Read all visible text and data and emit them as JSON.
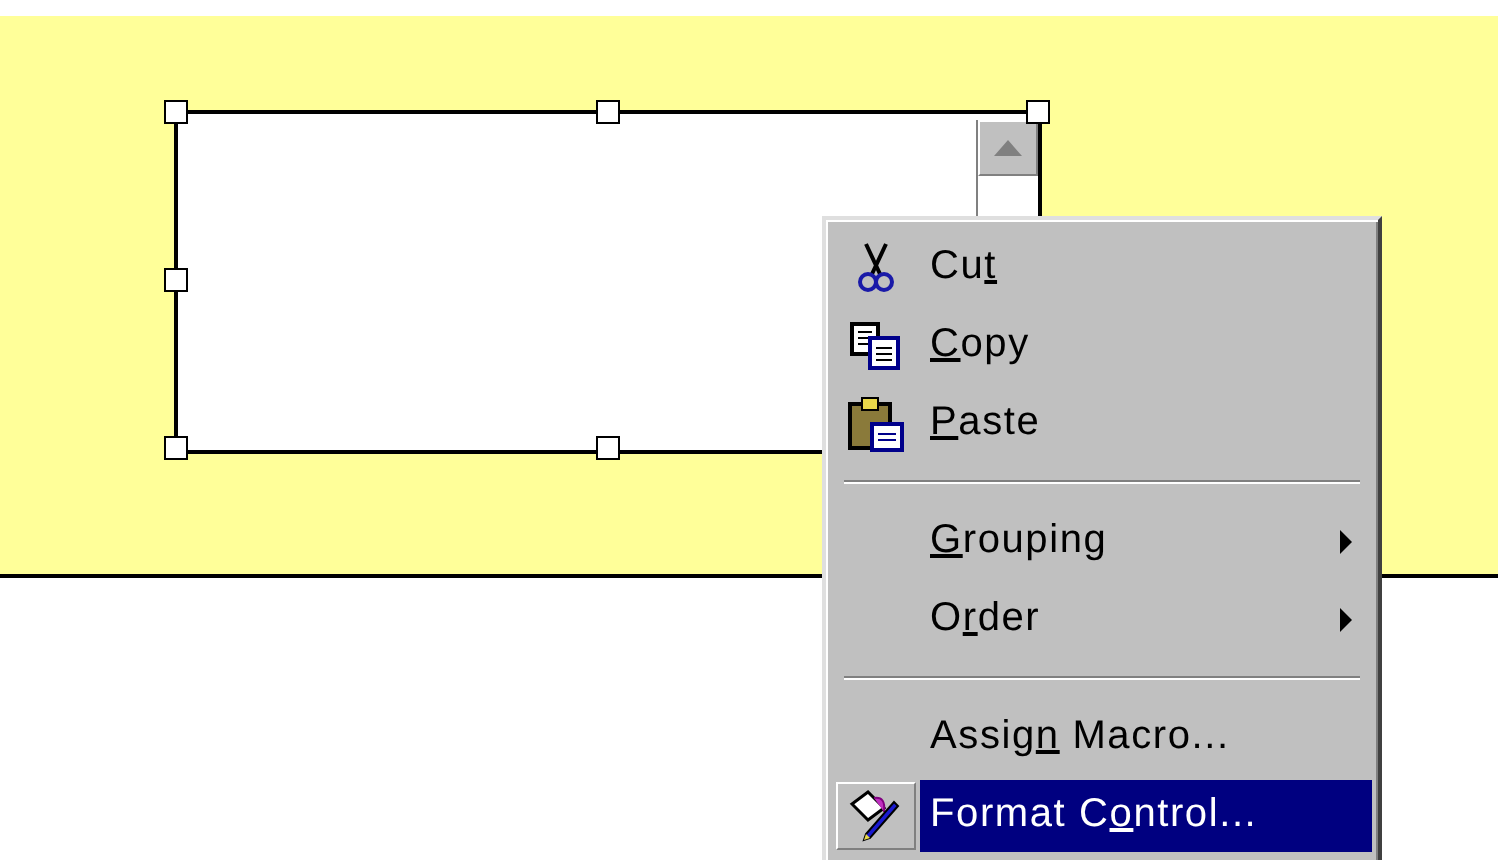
{
  "control": {
    "selected": true
  },
  "menu": {
    "items": [
      {
        "kind": "command",
        "text_before": "Cu",
        "access_key": "t",
        "selected": false
      },
      {
        "kind": "command",
        "access_key": "C",
        "text_after": "opy",
        "selected": false
      },
      {
        "kind": "command",
        "access_key": "P",
        "text_after": "aste",
        "selected": false
      },
      {
        "kind": "separator"
      },
      {
        "kind": "submenu",
        "access_key": "G",
        "text_after": "rouping",
        "selected": false
      },
      {
        "kind": "submenu",
        "text_before": "O",
        "access_key": "r",
        "text_after": "der",
        "selected": false
      },
      {
        "kind": "separator"
      },
      {
        "kind": "command",
        "text_before": "Assig",
        "access_key": "n",
        "text_after": " Macro...",
        "selected": false
      },
      {
        "kind": "command",
        "text_before": "Format C",
        "access_key": "o",
        "text_after": "ntrol...",
        "selected": true
      }
    ]
  }
}
